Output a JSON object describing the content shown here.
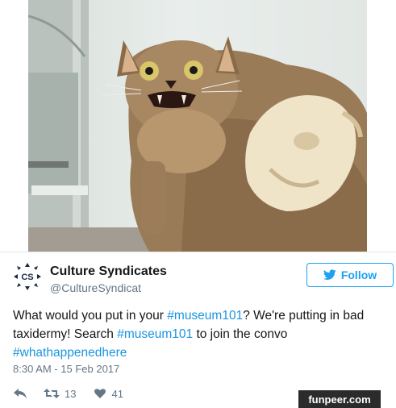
{
  "tweet": {
    "author": {
      "display_name": "Culture Syndicates",
      "handle": "@CultureSyndicat",
      "avatar_text": "CS"
    },
    "follow_label": "Follow",
    "text_segments": [
      {
        "text": "What would you put in your ",
        "hashtag": false
      },
      {
        "text": "#museum101",
        "hashtag": true
      },
      {
        "text": "? We're putting in bad taxidermy! Search ",
        "hashtag": false
      },
      {
        "text": "#museum101",
        "hashtag": true
      },
      {
        "text": " to join the convo ",
        "hashtag": false
      },
      {
        "text": "#whathappenedhere",
        "hashtag": true
      }
    ],
    "timestamp": "8:30 AM - 15 Feb 2017",
    "actions": {
      "retweet_count": "13",
      "like_count": "41"
    }
  },
  "icons": {
    "reply": "reply-icon",
    "retweet": "retweet-icon",
    "like": "heart-icon",
    "follow": "twitter-bird-icon"
  },
  "colors": {
    "accent": "#1da1f2",
    "hashtag": "#1b95e0",
    "muted": "#657786",
    "text": "#14171a"
  },
  "watermark": "funpeer.com"
}
